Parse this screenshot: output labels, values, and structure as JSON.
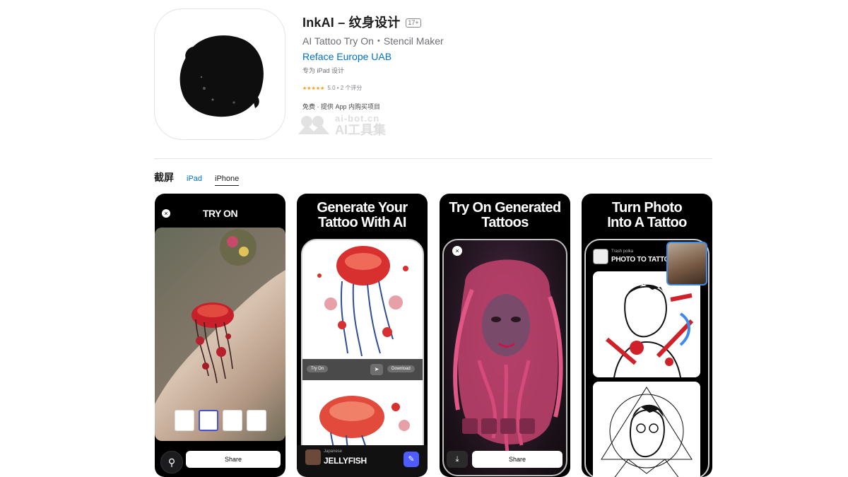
{
  "app": {
    "name": "InkAI – 纹身设计",
    "age_rating": "17+",
    "subtitle": "AI Tattoo Try On・Stencil Maker",
    "developer": "Reface Europe UAB",
    "designed_for": "专为 iPad 设计",
    "stars": "★★★★★",
    "rating": "5.0 • 2 个评分",
    "price": "免费 · 提供 App 内购买项目"
  },
  "watermark": {
    "url": "ai-bot.cn",
    "name": "AI工具集"
  },
  "screenshots": {
    "heading": "截屏",
    "tabs": [
      {
        "label": "iPad",
        "active": false
      },
      {
        "label": "iPhone",
        "active": true
      }
    ],
    "shot1": {
      "title": "TRY ON",
      "close_glyph": "×",
      "share": "Share",
      "ring_glyph": "⚲"
    },
    "shot2": {
      "headline_line1": "Generate Your",
      "headline_line2": "Tattoo With AI",
      "try_on": "Try On",
      "download": "Download",
      "send_glyph": "➤",
      "style": "Japanese",
      "name": "JELLYFISH",
      "edit_glyph": "✎"
    },
    "shot3": {
      "headline_line1": "Try On Generated",
      "headline_line2": "Tattoos",
      "close_glyph": "×",
      "download_glyph": "⤓",
      "share": "Share"
    },
    "shot4": {
      "headline_line1": "Turn Photo",
      "headline_line2": "Into A Tattoo",
      "style": "Trash polka",
      "name": "PHOTO TO TATTOO"
    }
  },
  "colors": {
    "link_blue": "#0070c9",
    "star_orange": "#f59c1a",
    "accent_purple": "#4d5bff",
    "tattoo_red": "#d0202a"
  }
}
